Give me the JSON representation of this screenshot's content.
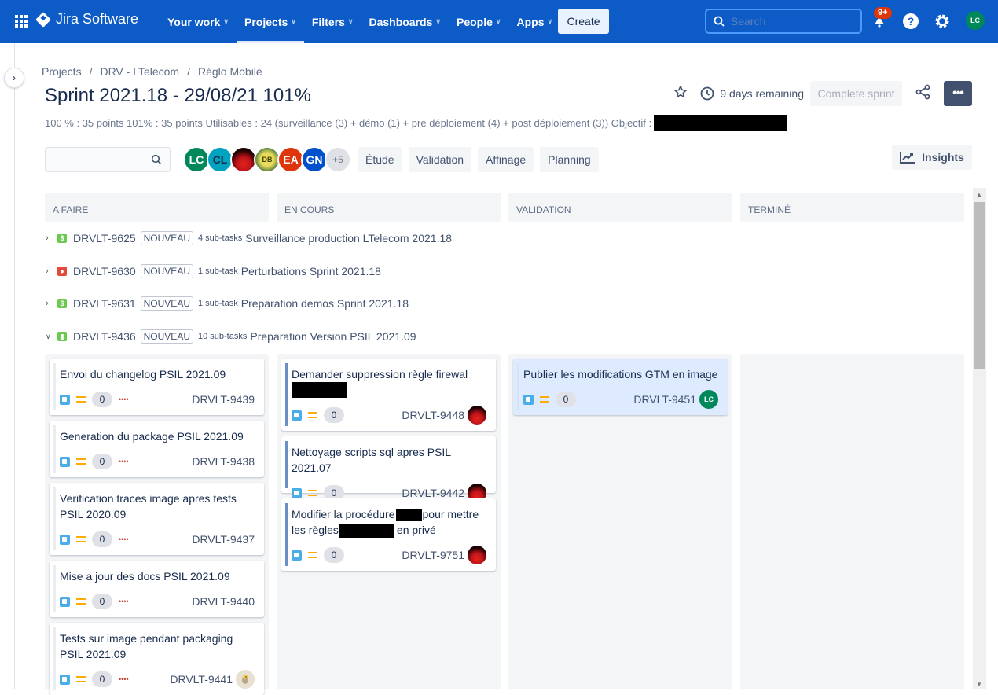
{
  "nav": {
    "product": "Jira Software",
    "items": [
      {
        "label": "Your work",
        "active": false
      },
      {
        "label": "Projects",
        "active": true
      },
      {
        "label": "Filters",
        "active": false
      },
      {
        "label": "Dashboards",
        "active": false
      },
      {
        "label": "People",
        "active": false
      },
      {
        "label": "Apps",
        "active": false
      }
    ],
    "create_label": "Create",
    "search_placeholder": "Search",
    "notifications_badge": "9+",
    "user_initials": "LC"
  },
  "breadcrumb": [
    "Projects",
    "DRV - LTelecom",
    "Réglo Mobile"
  ],
  "sprint": {
    "title": "Sprint 2021.18 - 29/08/21 101%",
    "days_remaining": "9 days remaining",
    "complete_label": "Complete sprint",
    "more_label": "•••",
    "description": "100 % : 35 points 101% : 35 points Utilisables : 24 (surveillance (3) + démo (1) + pre déploiement (4) + post déploiement (3)) Objectif :"
  },
  "filters": {
    "avatars": [
      {
        "initials": "LC",
        "color": "#00875a"
      },
      {
        "initials": "CL",
        "color": "#00a3bf"
      },
      {
        "initials": "",
        "color": "#c0141b"
      },
      {
        "initials": "DB",
        "color": "#e9d95a"
      },
      {
        "initials": "EA",
        "color": "#de350b"
      },
      {
        "initials": "GN",
        "color": "#0052cc"
      },
      {
        "initials": "+5",
        "color": "#dfe1e6"
      }
    ],
    "quick_filters": [
      "Étude",
      "Validation",
      "Affinage",
      "Planning"
    ],
    "insights_label": "Insights"
  },
  "columns": [
    "A FAIRE",
    "EN COURS",
    "VALIDATION",
    "TERMINÉ"
  ],
  "swimlanes": [
    {
      "key": "DRVLT-9625",
      "type": "sub-test",
      "type_color": "#6bc950",
      "status": "NOUVEAU",
      "subtasks": "4 sub-tasks",
      "title": "Surveillance production LTelecom 2021.18",
      "expanded": false
    },
    {
      "key": "DRVLT-9630",
      "type": "bug",
      "type_color": "#e5493a",
      "status": "NOUVEAU",
      "subtasks": "1 sub-task",
      "title": "Perturbations Sprint 2021.18",
      "expanded": false
    },
    {
      "key": "DRVLT-9631",
      "type": "sub-test",
      "type_color": "#6bc950",
      "status": "NOUVEAU",
      "subtasks": "1 sub-task",
      "title": "Preparation demos Sprint 2021.18",
      "expanded": false
    },
    {
      "key": "DRVLT-9436",
      "type": "story",
      "type_color": "#6bc950",
      "status": "NOUVEAU",
      "subtasks": "10 sub-tasks",
      "title": "Preparation Version PSIL 2021.09",
      "expanded": true
    }
  ],
  "cards": {
    "todo": [
      {
        "title": "Envoi du changelog PSIL 2021.09",
        "estimate": "0",
        "dots": "••••",
        "key": "DRVLT-9439"
      },
      {
        "title": "Generation du package PSIL 2021.09",
        "estimate": "0",
        "dots": "••••",
        "key": "DRVLT-9438"
      },
      {
        "title": "Verification traces image apres tests PSIL 2020.09",
        "estimate": "0",
        "dots": "••••",
        "key": "DRVLT-9437"
      },
      {
        "title": "Mise a jour des docs PSIL 2021.09",
        "estimate": "0",
        "dots": "••••",
        "key": "DRVLT-9440"
      },
      {
        "title": "Tests sur image pendant packaging PSIL 2021.09",
        "estimate": "0",
        "dots": "••••",
        "key": "DRVLT-9441"
      }
    ],
    "inprogress": [
      {
        "title": "Demander suppression règle firewal",
        "estimate": "0",
        "key": "DRVLT-9448"
      },
      {
        "title": "Nettoyage scripts sql apres PSIL 2021.07",
        "estimate": "0",
        "key": "DRVLT-9442"
      },
      {
        "title_a": "Modifier la procédure",
        "title_b": "pour mettre les règles",
        "title_c": "en privé",
        "estimate": "0",
        "key": "DRVLT-9751"
      }
    ],
    "validation": [
      {
        "title": "Publier les modifications GTM en image",
        "estimate": "0",
        "key": "DRVLT-9451",
        "assignee": "LC"
      }
    ]
  }
}
